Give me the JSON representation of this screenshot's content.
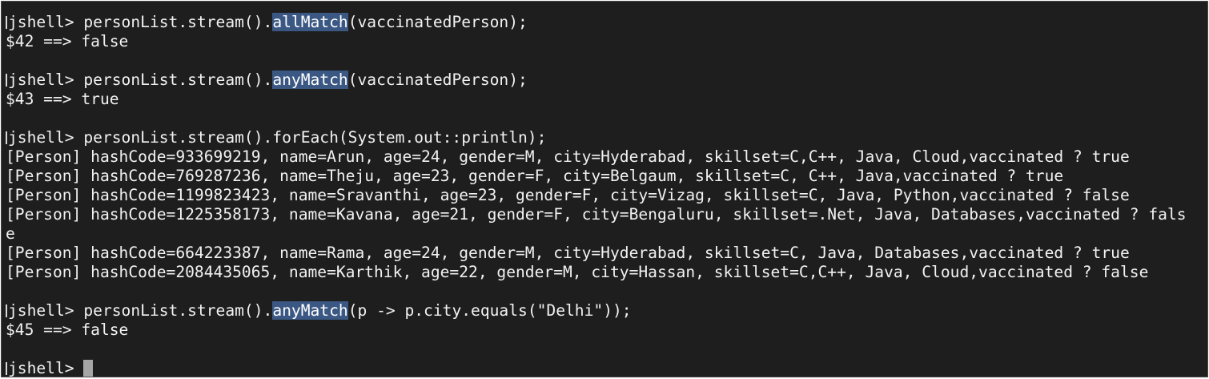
{
  "prompt": "jshell> ",
  "lines": {
    "l1": {
      "a": "personList.stream().",
      "hl": "allMatch",
      "b": "(vaccinatedPerson);"
    },
    "l2": "$42 ==> false",
    "l4": {
      "a": "personList.stream().",
      "hl": "anyMatch",
      "b": "(vaccinatedPerson);"
    },
    "l5": "$43 ==> true",
    "l7": "personList.stream().forEach(System.out::println);",
    "out": [
      "[Person] hashCode=933699219, name=Arun, age=24, gender=M, city=Hyderabad, skillset=C,C++, Java, Cloud,vaccinated ? true",
      "[Person] hashCode=769287236, name=Theju, age=23, gender=F, city=Belgaum, skillset=C, C++, Java,vaccinated ? true",
      "[Person] hashCode=1199823423, name=Sravanthi, age=23, gender=F, city=Vizag, skillset=C, Java, Python,vaccinated ? false",
      "[Person] hashCode=1225358173, name=Kavana, age=21, gender=F, city=Bengaluru, skillset=.Net, Java, Databases,vaccinated ? fals",
      "e",
      "[Person] hashCode=664223387, name=Rama, age=24, gender=M, city=Hyderabad, skillset=C, Java, Databases,vaccinated ? true",
      "[Person] hashCode=2084435065, name=Karthik, age=22, gender=M, city=Hassan, skillset=C,C++, Java, Cloud,vaccinated ? false"
    ],
    "l16": {
      "a": "personList.stream().",
      "hl": "anyMatch",
      "b": "(p -> p.city.equals(\"Delhi\"));"
    },
    "l17": "$45 ==> false"
  }
}
